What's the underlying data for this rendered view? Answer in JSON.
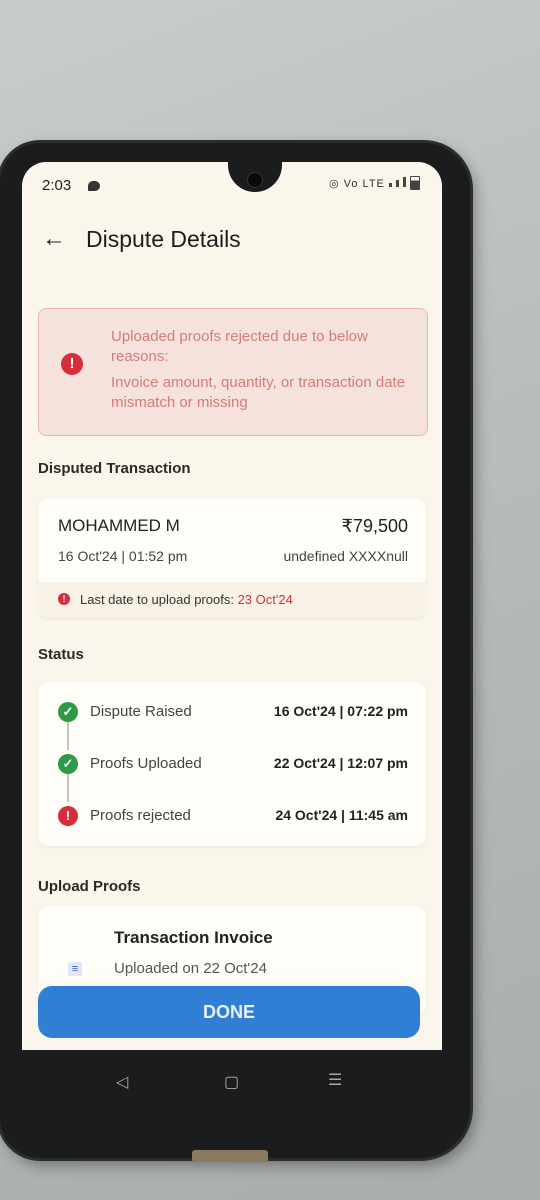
{
  "status_bar": {
    "time": "2:03",
    "network_label": "Vo LTE"
  },
  "header": {
    "title": "Dispute Details"
  },
  "alert": {
    "title": "Uploaded proofs rejected due to below reasons:",
    "reason": "Invoice amount, quantity, or transaction date mismatch or missing"
  },
  "disputed_transaction": {
    "section_title": "Disputed Transaction",
    "name": "MOHAMMED M",
    "amount": "₹79,500",
    "date": "16 Oct'24 | 01:52 pm",
    "account": "undefined XXXXnull",
    "deadline_label": "Last date to upload proofs:",
    "deadline_date": "23 Oct'24"
  },
  "status": {
    "section_title": "Status",
    "steps": [
      {
        "label": "Dispute Raised",
        "time": "16 Oct'24 | 07:22 pm",
        "state": "done"
      },
      {
        "label": "Proofs Uploaded",
        "time": "22 Oct'24 | 12:07 pm",
        "state": "done"
      },
      {
        "label": "Proofs rejected",
        "time": "24 Oct'24 | 11:45 am",
        "state": "error"
      }
    ]
  },
  "upload_proofs": {
    "section_title": "Upload Proofs",
    "doc_title": "Transaction Invoice",
    "doc_subtitle": "Uploaded on 22 Oct'24"
  },
  "footer": {
    "done_label": "DONE"
  },
  "colors": {
    "primary": "#2f7fd4",
    "error": "#d62e3a",
    "success": "#2e9a45",
    "alert_bg": "#f6e2dc"
  }
}
